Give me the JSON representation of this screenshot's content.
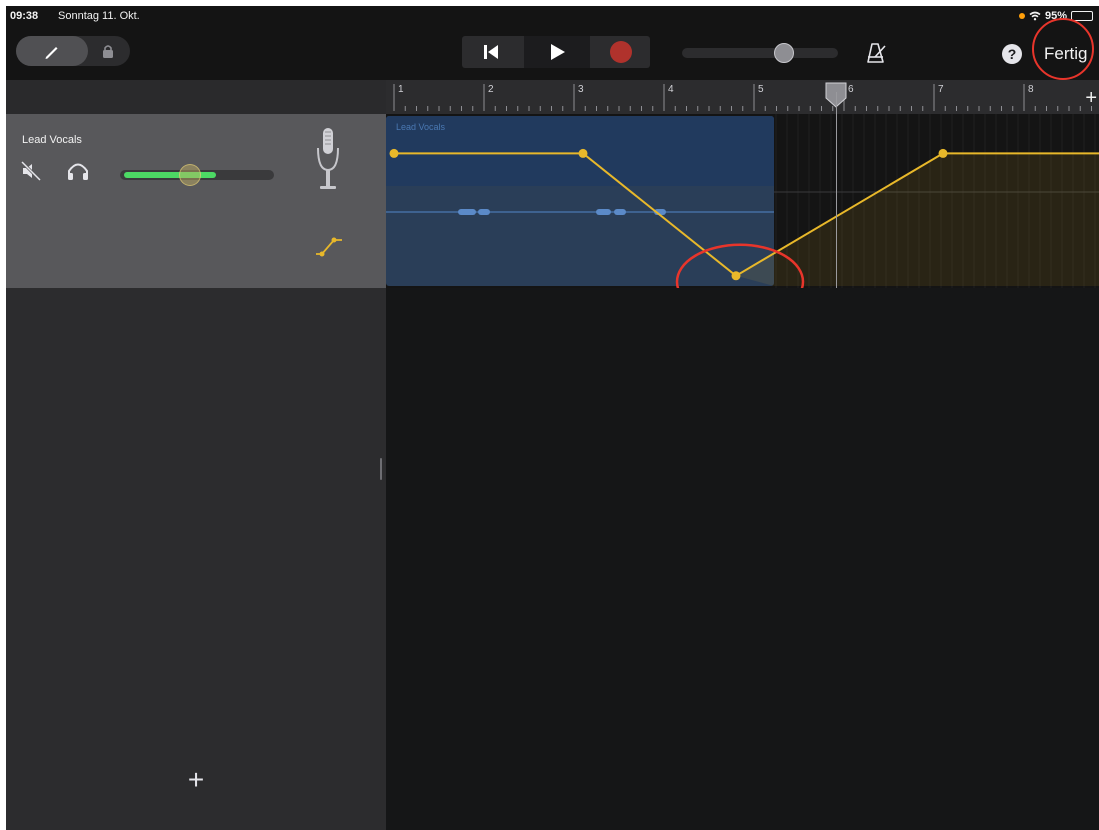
{
  "status_bar": {
    "time": "09:38",
    "date": "Sonntag 11. Okt.",
    "battery": "95%"
  },
  "toolbar": {
    "done_label": "Fertig",
    "help_label": "?",
    "master_volume": 0.68
  },
  "track": {
    "name": "Lead Vocals",
    "volume": 0.42,
    "region_label": "Lead Vocals"
  },
  "ruler": {
    "bars": [
      "1",
      "2",
      "3",
      "4",
      "5",
      "6",
      "7",
      "8"
    ],
    "playhead_bar": 6
  },
  "automation": {
    "points": [
      {
        "bar": 1.0,
        "level": 0.78
      },
      {
        "bar": 3.1,
        "level": 0.78
      },
      {
        "bar": 4.8,
        "level": 0.06
      },
      {
        "bar": 7.1,
        "level": 0.78
      },
      {
        "bar": 9.0,
        "level": 0.78
      }
    ],
    "highlighted_point_index": 2
  },
  "colors": {
    "automation": "#e8b82a",
    "annotation": "#e8352b",
    "region": "#2a3e58"
  },
  "icons": {
    "pencil": "pencil-icon",
    "lock": "lock-icon",
    "rewind": "skip-back-icon",
    "play": "play-icon",
    "record": "record-icon",
    "metronome": "metronome-icon",
    "mute": "speaker-mute-icon",
    "headphones": "headphones-icon",
    "mic": "microphone-icon",
    "automation": "automation-curve-icon",
    "add": "plus-icon"
  }
}
